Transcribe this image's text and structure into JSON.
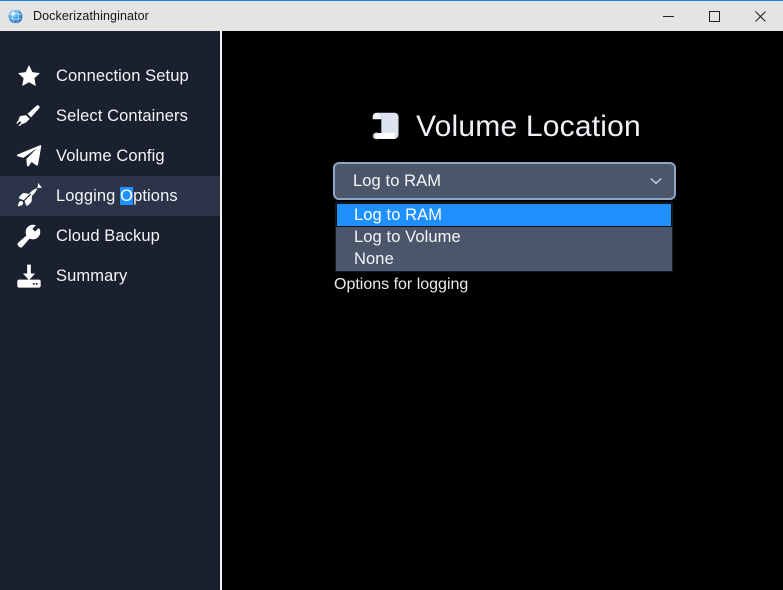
{
  "window": {
    "title": "Dockerizathinginator",
    "icon": "app-globe-icon",
    "controls": {
      "minimize_label": "Minimize",
      "maximize_label": "Maximize",
      "close_label": "Close"
    }
  },
  "sidebar": {
    "items": [
      {
        "label": "Connection Setup",
        "icon": "star-icon",
        "active": false
      },
      {
        "label": "Select Containers",
        "icon": "paintbrush-icon",
        "active": false
      },
      {
        "label": "Volume Config",
        "icon": "paper-plane-icon",
        "active": false
      },
      {
        "label": "Logging",
        "accel": "O",
        "label_tail": "ptions",
        "icon": "rocket-icon",
        "active": true
      },
      {
        "label": "Cloud Backup",
        "icon": "wrench-icon",
        "active": false
      },
      {
        "label": "Summary",
        "icon": "inbox-download-icon",
        "active": false
      }
    ]
  },
  "main": {
    "header": {
      "icon": "scroll-icon",
      "title": "Volume Location"
    },
    "obscured_label": "Options for logging",
    "combobox": {
      "name": "volume-location-select",
      "value": "Log to RAM",
      "expanded": true,
      "options": [
        {
          "label": "Log to RAM",
          "selected": true
        },
        {
          "label": "Log to Volume",
          "selected": false
        },
        {
          "label": "None",
          "selected": false
        }
      ]
    }
  },
  "colors": {
    "titlebar_bg": "#e4e4e4",
    "titlebar_accent": "#1f7fd4",
    "sidebar_bg": "#1a202e",
    "sidebar_active_bg": "#2b3448",
    "content_bg": "#000000",
    "combo_bg": "#4b566b",
    "combo_border": "#8fa6c4",
    "highlight_blue": "#1e90ff",
    "text_light": "#f3f4f6"
  }
}
